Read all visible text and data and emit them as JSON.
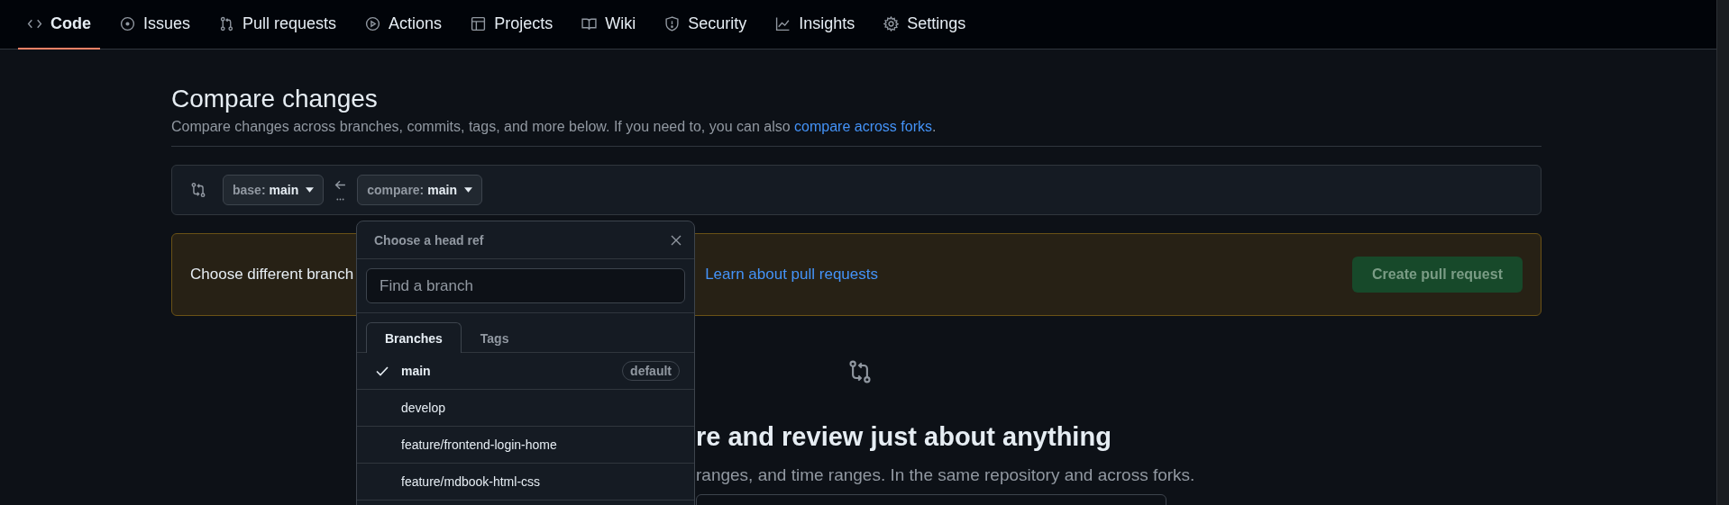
{
  "nav": {
    "tabs": [
      {
        "label": "Code",
        "selected": true
      },
      {
        "label": "Issues",
        "selected": false
      },
      {
        "label": "Pull requests",
        "selected": false
      },
      {
        "label": "Actions",
        "selected": false
      },
      {
        "label": "Projects",
        "selected": false
      },
      {
        "label": "Wiki",
        "selected": false
      },
      {
        "label": "Security",
        "selected": false
      },
      {
        "label": "Insights",
        "selected": false
      },
      {
        "label": "Settings",
        "selected": false
      }
    ]
  },
  "header": {
    "title": "Compare changes",
    "description": "Compare changes across branches, commits, tags, and more below. If you need to, you can also ",
    "link": "compare across forks",
    "suffix": "."
  },
  "range": {
    "base": {
      "prefix": "base:",
      "ref": "main"
    },
    "compare": {
      "prefix": "compare:",
      "ref": "main"
    }
  },
  "flash": {
    "text": "Choose different branch",
    "link": "Learn about pull requests",
    "button": {
      "label": "Create pull request",
      "disabled": true
    }
  },
  "blankslate": {
    "heading": "re and review just about anything",
    "text": "ranges, and time ranges. In the same repository and across forks."
  },
  "dropdown": {
    "title": "Choose a head ref",
    "search": {
      "placeholder": "Find a branch"
    },
    "tabs": [
      {
        "label": "Branches",
        "selected": true
      },
      {
        "label": "Tags",
        "selected": false
      }
    ],
    "branches": [
      {
        "name": "main",
        "selected": true,
        "badge": "default"
      },
      {
        "name": "develop",
        "selected": false
      },
      {
        "name": "feature/frontend-login-home",
        "selected": false
      },
      {
        "name": "feature/mdbook-html-css",
        "selected": false
      }
    ]
  }
}
